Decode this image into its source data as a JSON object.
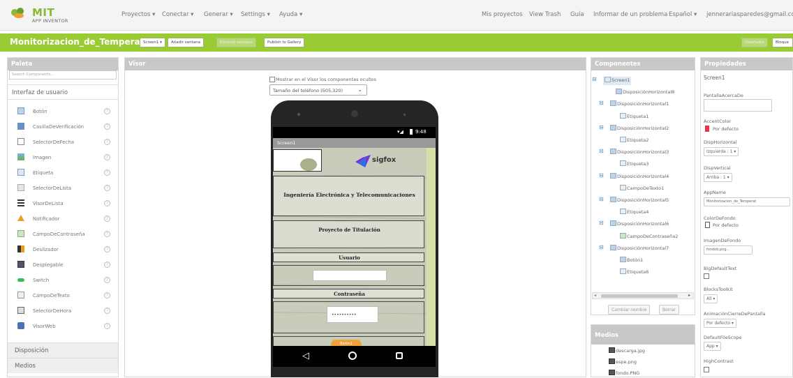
{
  "header": {
    "logo_mit": "MIT",
    "logo_sub": "APP INVENTOR",
    "menu_left": [
      "Proyectos ▾",
      "Conectar ▾",
      "Generar ▾",
      "Settings ▾",
      "Ayuda ▾"
    ],
    "menu_right": [
      "Mis proyectos",
      "View Trash",
      "Guía",
      "Informar de un problema",
      "Español ▾",
      "jennerariasparedes@gmail.com ▾"
    ]
  },
  "project": {
    "name": "Monitorizacion_de_Temperatura",
    "screen_btn": "Screen1 ▾",
    "add_screen": "Añadir ventana",
    "remove_screen": "Eliminar ventana",
    "publish": "Publish to Gallery",
    "designer": "Diseñador",
    "blocks": "Bloque"
  },
  "palette": {
    "title": "Paleta",
    "search_placeholder": "Search Components...",
    "category": "Interfaz de usuario",
    "items": [
      {
        "label": "Botón",
        "icon": "button-icon"
      },
      {
        "label": "CasillaDeVerificación",
        "icon": "checkbox-icon"
      },
      {
        "label": "SelectorDeFecha",
        "icon": "calendar-icon"
      },
      {
        "label": "Imagen",
        "icon": "image-icon"
      },
      {
        "label": "Etiqueta",
        "icon": "label-icon"
      },
      {
        "label": "SelectorDeLista",
        "icon": "list-picker-icon"
      },
      {
        "label": "VisorDeLista",
        "icon": "list-view-icon"
      },
      {
        "label": "Notificador",
        "icon": "warning-icon"
      },
      {
        "label": "CampoDeContraseña",
        "icon": "password-icon"
      },
      {
        "label": "Deslizador",
        "icon": "slider-icon"
      },
      {
        "label": "Desplegable",
        "icon": "spinner-icon"
      },
      {
        "label": "Switch",
        "icon": "switch-icon"
      },
      {
        "label": "CampoDeTexto",
        "icon": "textbox-icon"
      },
      {
        "label": "SelectorDeHora",
        "icon": "clock-icon"
      },
      {
        "label": "VisorWeb",
        "icon": "globe-icon"
      }
    ],
    "help": "?",
    "sections": [
      "Disposición",
      "Medios"
    ]
  },
  "viewer": {
    "title": "Visor",
    "show_hidden": "Mostrar en el Visor los componentes ocultos",
    "size": "Tamaño del teléfono (505,320)",
    "time": "9:48",
    "screen_title": "Screen1",
    "sigfox": "sigfox",
    "label1": "Ingeniería Electrónica y Telecomunicaciones",
    "label2": "Proyecto de Titulación",
    "label3": "Usuario",
    "label4": "Contraseña",
    "password": "••••••••••",
    "button": "Botón1"
  },
  "components": {
    "title": "Componentes",
    "tree": [
      {
        "label": "Screen1",
        "depth": 0,
        "kind": "screen",
        "toggle": "⊟"
      },
      {
        "label": "DisposiciónHorizontal8",
        "depth": 1,
        "kind": "hbox",
        "toggle": ""
      },
      {
        "label": "DisposiciónHorizontal1",
        "depth": 1,
        "kind": "hbox",
        "toggle": "⊟"
      },
      {
        "label": "Etiqueta1",
        "depth": 2,
        "kind": "label",
        "toggle": ""
      },
      {
        "label": "DisposiciónHorizontal2",
        "depth": 1,
        "kind": "hbox",
        "toggle": "⊟"
      },
      {
        "label": "Etiqueta2",
        "depth": 2,
        "kind": "label",
        "toggle": ""
      },
      {
        "label": "DisposiciónHorizontal3",
        "depth": 1,
        "kind": "hbox",
        "toggle": "⊟"
      },
      {
        "label": "Etiqueta3",
        "depth": 2,
        "kind": "label",
        "toggle": ""
      },
      {
        "label": "DisposiciónHorizontal4",
        "depth": 1,
        "kind": "hbox",
        "toggle": "⊟"
      },
      {
        "label": "CampoDeTexto1",
        "depth": 2,
        "kind": "text",
        "toggle": ""
      },
      {
        "label": "DisposiciónHorizontal5",
        "depth": 1,
        "kind": "hbox",
        "toggle": "⊟"
      },
      {
        "label": "Etiqueta4",
        "depth": 2,
        "kind": "label",
        "toggle": ""
      },
      {
        "label": "DisposiciónHorizontal6",
        "depth": 1,
        "kind": "hbox",
        "toggle": "⊟"
      },
      {
        "label": "CampoDeContraseña2",
        "depth": 2,
        "kind": "pass",
        "toggle": ""
      },
      {
        "label": "DisposiciónHorizontal7",
        "depth": 1,
        "kind": "hbox",
        "toggle": "⊟"
      },
      {
        "label": "Botón1",
        "depth": 2,
        "kind": "button",
        "toggle": ""
      },
      {
        "label": "Etiqueta6",
        "depth": 2,
        "kind": "label",
        "toggle": ""
      }
    ],
    "rename": "Cambiar nombre",
    "delete": "Borrar"
  },
  "media": {
    "title": "Medios",
    "files": [
      "descarga.jpg",
      "espe.png",
      "fondo.PNG"
    ]
  },
  "properties": {
    "title": "Propiedades",
    "component": "Screen1",
    "about_label": "PantallaAcercaDe",
    "accent_label": "AccentColor",
    "accent_value": "Por defecto",
    "accent_color": "#e8344e",
    "align_h_label": "DispHorizontal",
    "align_h_value": "Izquierda : 1 ▾",
    "align_v_label": "DispVertical",
    "align_v_value": "Arriba : 1 ▾",
    "appname_label": "AppName",
    "appname_value": "Monitorizacion_de_Temperat",
    "bgcolor_label": "ColorDeFondo",
    "bgcolor_value": "Por defecto",
    "bgimage_label": "ImagenDeFondo",
    "bgimage_value": "fondob.png...",
    "bigtext_label": "BigDefaultText",
    "blocks_label": "BlocksToolkit",
    "blocks_value": "All ▾",
    "anim_label": "AnimaciónCierreDePantalla",
    "anim_value": "Por defecto ▾",
    "scope_label": "DefaultFileScope",
    "scope_value": "App ▾",
    "contrast_label": "HighContrast"
  }
}
